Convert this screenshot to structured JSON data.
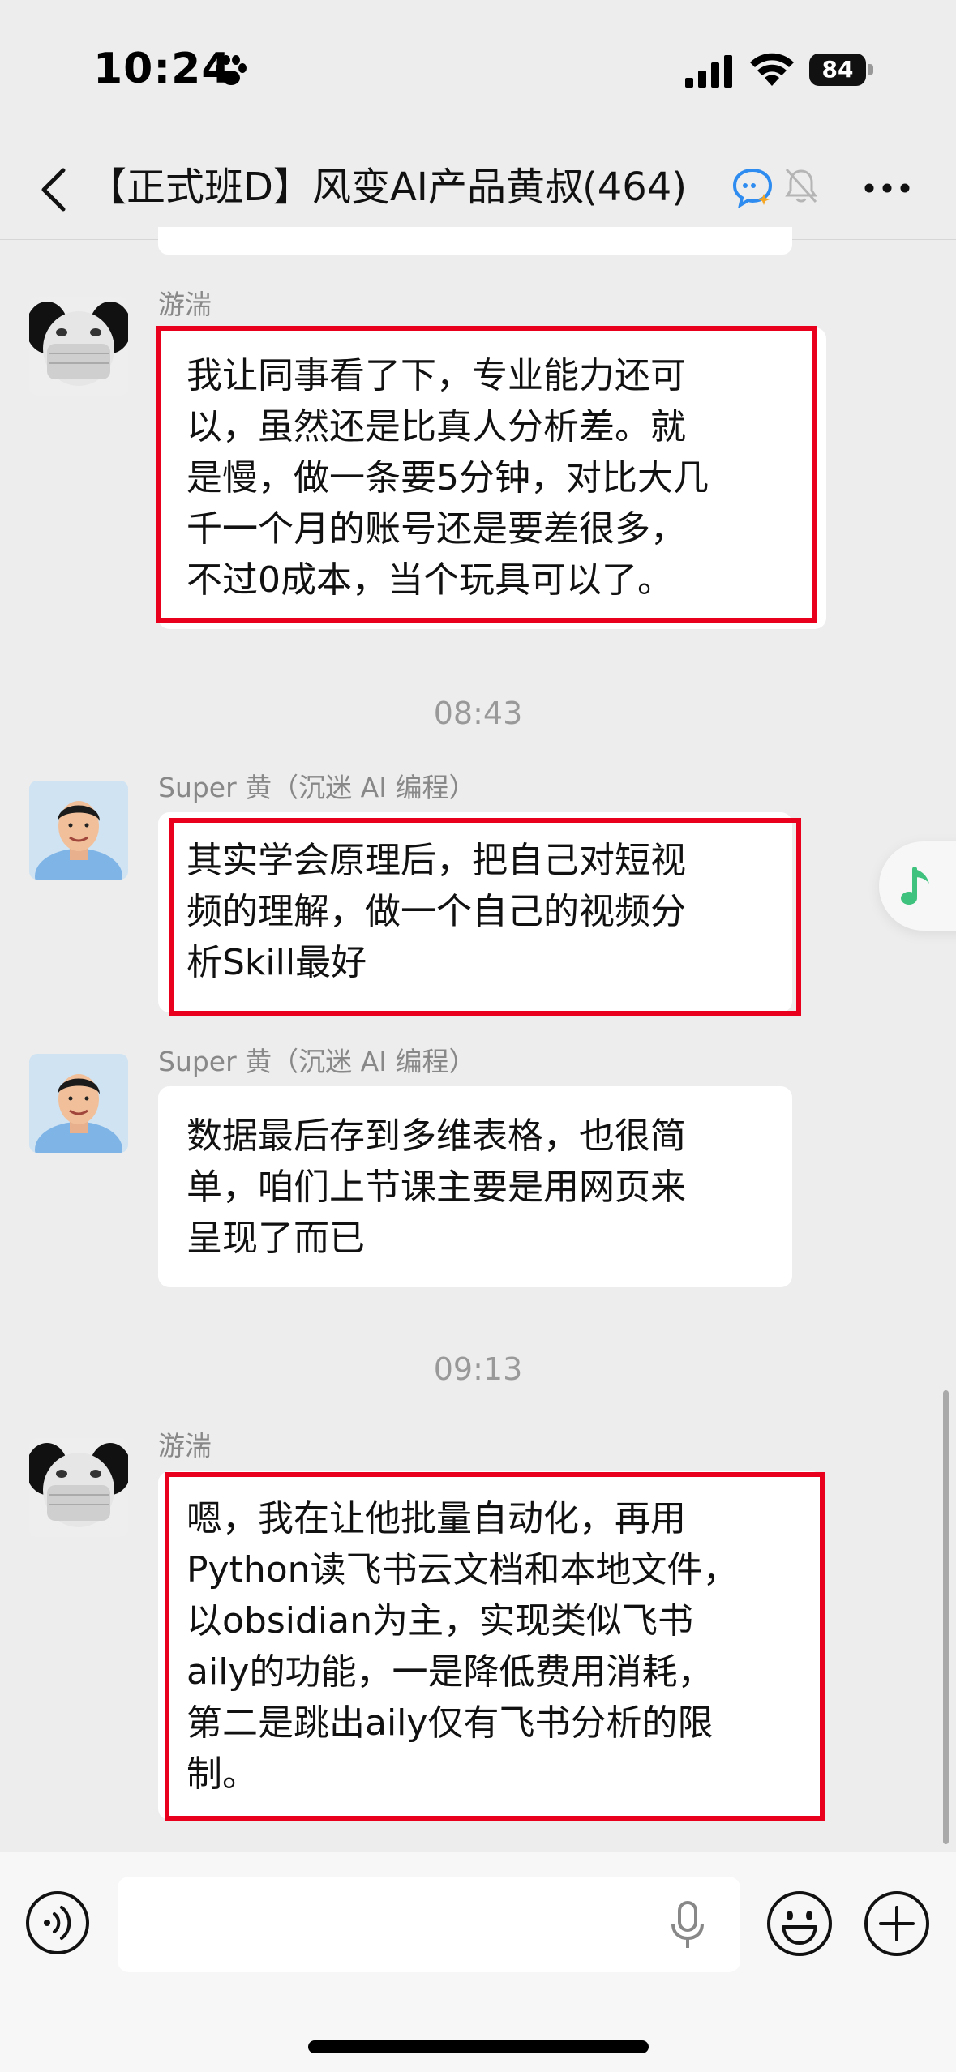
{
  "status_bar": {
    "time": "10:24",
    "battery": "84"
  },
  "nav": {
    "title": "【正式班D】风变AI产品黄叔",
    "member_count": "(464)"
  },
  "messages": [
    {
      "sender": "游湍",
      "text_lines": [
        "我让同事看了下，专业能力还可",
        "以，虽然还是比真人分析差。就",
        "是慢，做一条要5分钟，对比大几",
        "千一个月的账号还是要差很多，",
        "不过0成本，当个玩具可以了。"
      ],
      "highlighted": true
    },
    {
      "time": "08:43"
    },
    {
      "sender": "Super 黄（沉迷 AI 编程）",
      "text_lines": [
        "其实学会原理后，把自己对短视",
        "频的理解，做一个自己的视频分",
        "析Skill最好"
      ],
      "highlighted": true
    },
    {
      "sender": "Super 黄（沉迷 AI 编程）",
      "text_lines": [
        "数据最后存到多维表格，也很简",
        "单，咱们上节课主要是用网页来",
        "呈现了而已"
      ],
      "highlighted": false
    },
    {
      "time": "09:13"
    },
    {
      "sender": "游湍",
      "text_lines": [
        "嗯，我在让他批量自动化，再用",
        "Python读飞书云文档和本地文件，",
        "以obsidian为主，实现类似飞书",
        "aily的功能，一是降低费用消耗，",
        "第二是跳出aily仅有飞书分析的限",
        "制。"
      ],
      "highlighted": true
    }
  ],
  "input": {
    "value": ""
  },
  "icons": {
    "back": "chevron-left-icon",
    "paw": "paw-icon",
    "signal": "signal-icon",
    "wifi": "wifi-icon",
    "ai_bubble": "ai-chat-bubble-icon",
    "mute": "bell-muted-icon",
    "more": "more-dots-icon",
    "music": "music-note-icon",
    "voice": "voice-icon",
    "mic": "microphone-icon",
    "emoji": "emoji-icon",
    "plus": "plus-icon"
  },
  "colors": {
    "background": "#ededed",
    "bubble": "#ffffff",
    "highlight": "#e8001c",
    "timestamp": "#999999",
    "music_accent": "#3ec27d"
  }
}
